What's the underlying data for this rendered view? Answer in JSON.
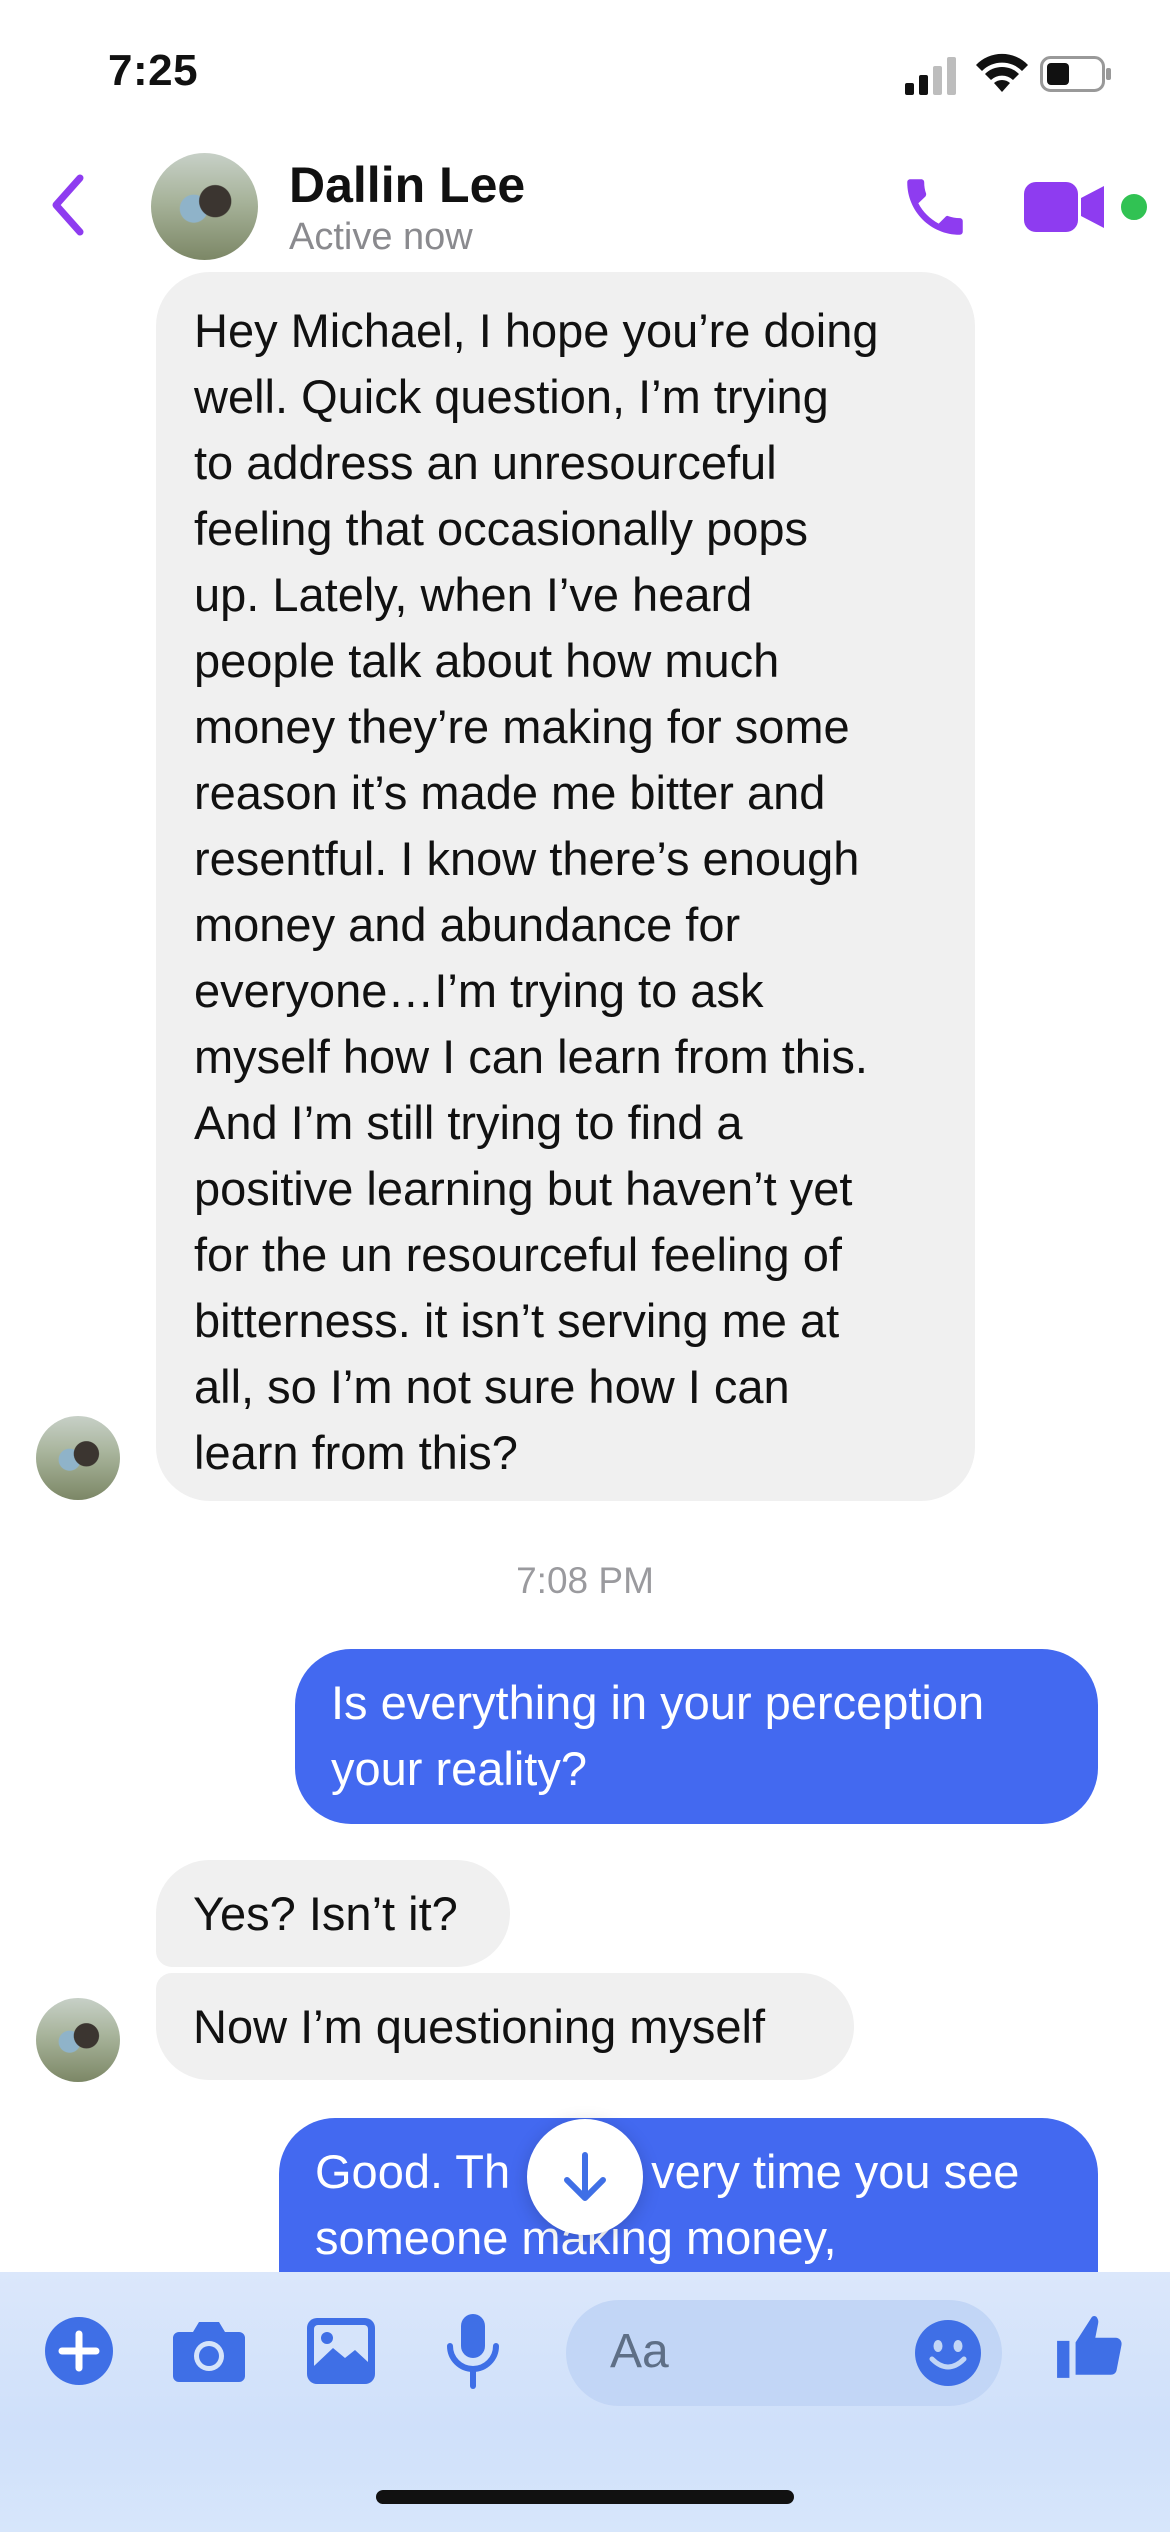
{
  "status_bar": {
    "time": "7:25"
  },
  "header": {
    "name": "Dallin Lee",
    "status": "Active now"
  },
  "messages": [
    {
      "direction": "incoming",
      "text": "Hey Michael, I hope you’re doing\nwell. Quick question, I’m trying\nto address an unresourceful\nfeeling that occasionally pops\nup. Lately, when I’ve heard\npeople talk about how much\nmoney they’re making for some\nreason it’s made me bitter and\nresentful. I know there’s enough\nmoney and abundance for\neveryone…I’m trying to ask\nmyself how I can learn from this.\nAnd I’m still trying to find a\npositive learning but haven’t yet\nfor the un resourceful feeling of\nbitterness.  it isn’t serving me at\nall, so I’m not sure how I can\nlearn from this?"
    },
    {
      "direction": "timestamp",
      "text": "7:08 PM"
    },
    {
      "direction": "outgoing",
      "text": "Is everything in your perception\nyour reality?"
    },
    {
      "direction": "incoming",
      "text": "Yes? Isn’t it?"
    },
    {
      "direction": "incoming",
      "text": "Now I’m questioning myself"
    },
    {
      "direction": "outgoing",
      "text": "Good. Th      very time you see\nsomeone making money,"
    }
  ],
  "composer": {
    "placeholder": "Aa"
  },
  "colors": {
    "accent": "#8e3cf0",
    "outgoing_bubble": "#4369f0",
    "composer_icons": "#3f6fe6"
  },
  "icons": [
    "back-arrow-icon",
    "phone-icon",
    "video-icon",
    "plus-icon",
    "camera-icon",
    "gallery-icon",
    "mic-icon",
    "emoji-icon",
    "thumbs-up-icon",
    "arrow-down-icon"
  ]
}
